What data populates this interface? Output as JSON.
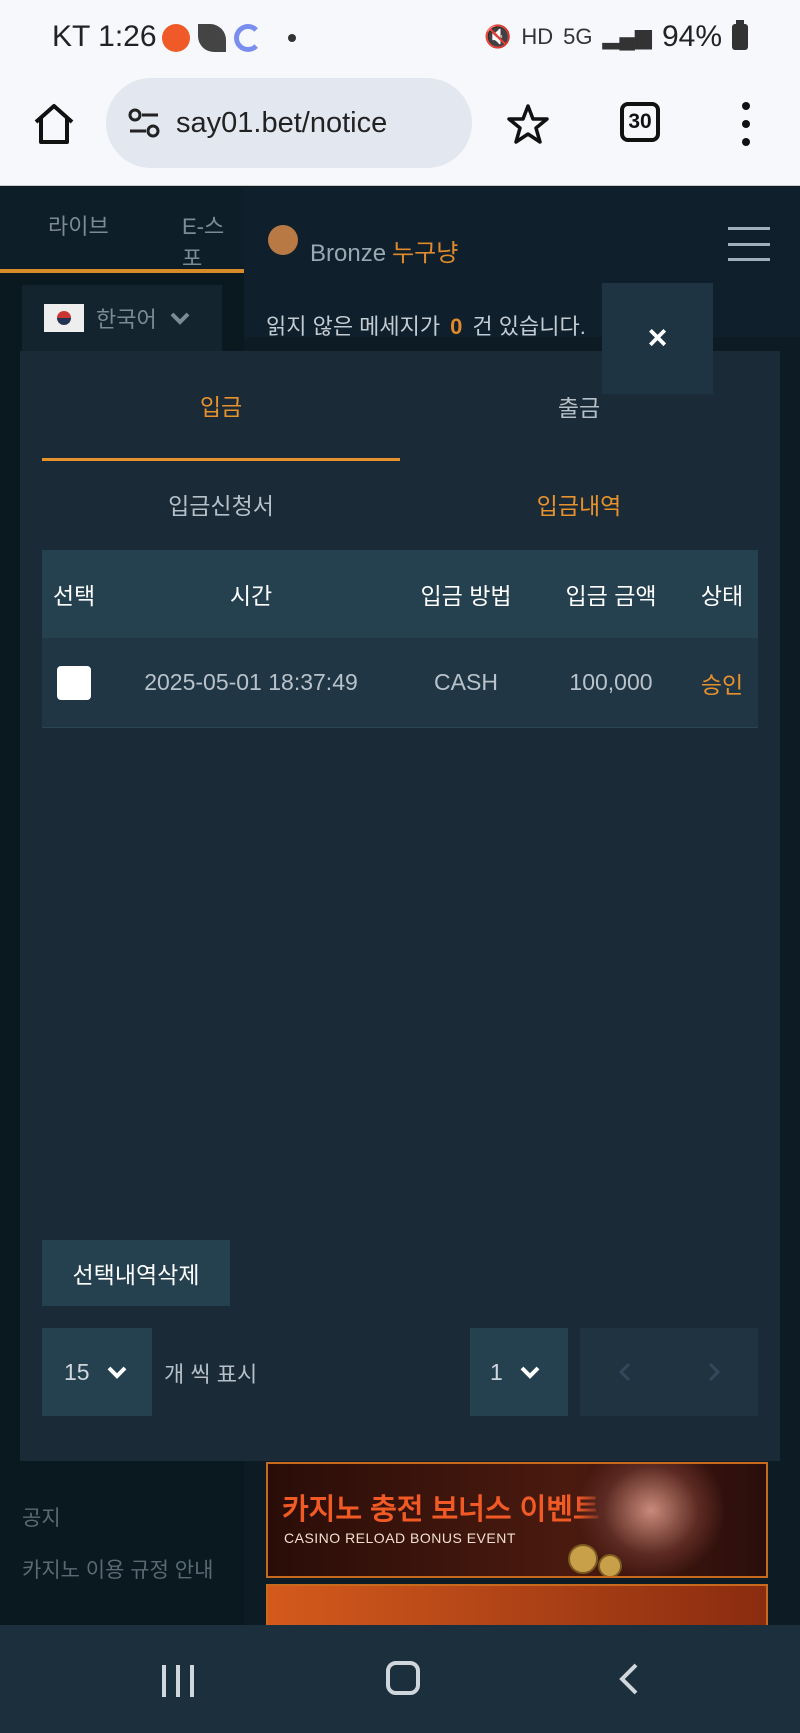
{
  "status_bar": {
    "time": "KT 1:26",
    "battery": "94%"
  },
  "browser": {
    "url": "say01.bet/notice",
    "tab_count": "30"
  },
  "left_nav": {
    "tabs": [
      "라이브",
      "E-스포"
    ],
    "language": "한국어",
    "links": [
      "공지",
      "카지노 이용 규정 안내"
    ]
  },
  "header": {
    "rank": "Bronze",
    "username": "누구냥",
    "message_prefix": "읽지 않은 메세지가",
    "message_count": "0",
    "message_suffix": "건 있습니다."
  },
  "modal": {
    "close_label": "×",
    "main_tabs": [
      "입금",
      "출금"
    ],
    "sub_tabs": [
      "입금신청서",
      "입금내역"
    ],
    "table": {
      "headers": [
        "선택",
        "시간",
        "입금 방법",
        "입금 금액",
        "상태"
      ],
      "rows": [
        {
          "time": "2025-05-01 18:37:49",
          "method": "CASH",
          "amount": "100,000",
          "status": "승인"
        }
      ]
    },
    "delete_button": "선택내역삭제",
    "per_page_value": "15",
    "per_page_label": "개 씩 표시",
    "page_value": "1"
  },
  "banner": {
    "title": "카지노 충전 보너스 이벤트",
    "subtitle": "CASINO RELOAD BONUS EVENT"
  },
  "colors": {
    "accent": "#e8922e",
    "modal_bg": "#1a2a36",
    "header_row": "#25404f"
  }
}
